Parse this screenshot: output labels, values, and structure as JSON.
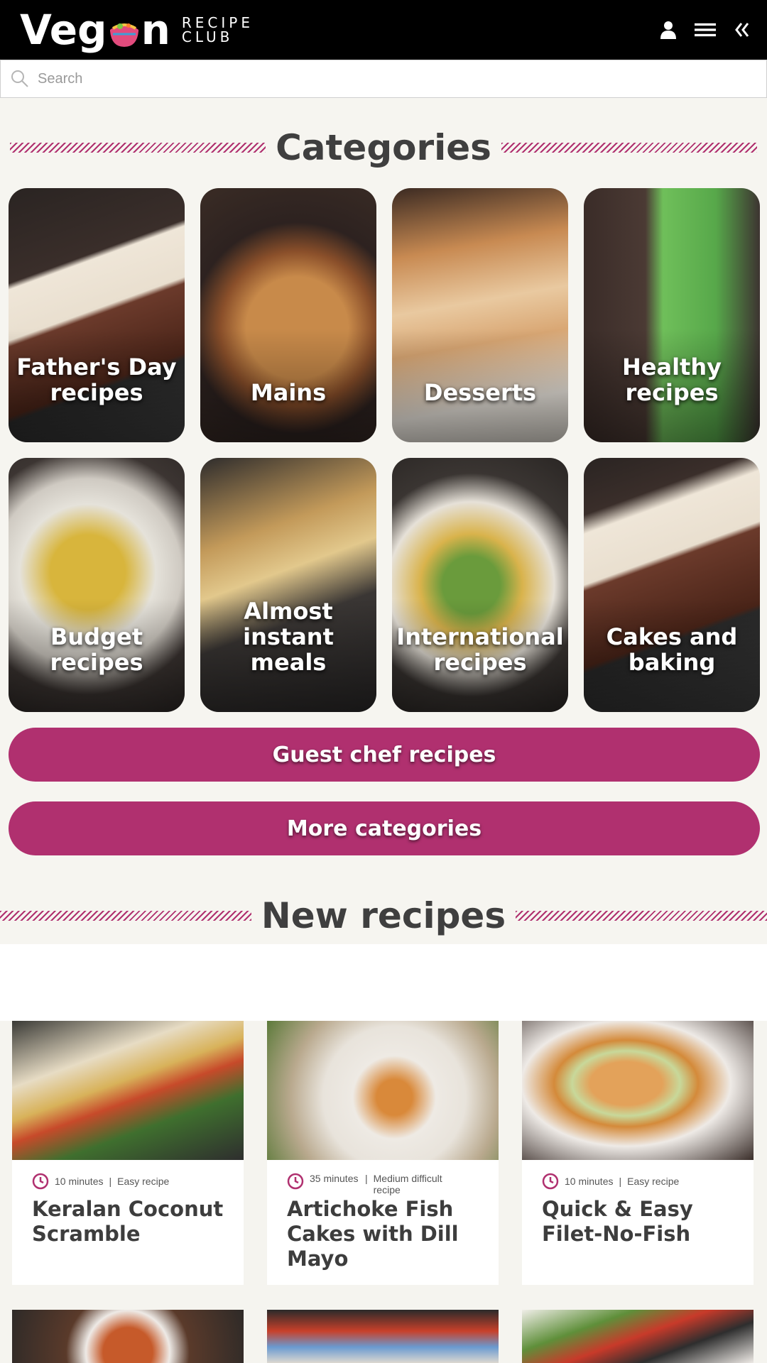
{
  "header": {
    "logo_main": "Vegan",
    "logo_sub_top": "RECIPE",
    "logo_sub_bottom": "CLUB",
    "icons": [
      "user-icon",
      "menu-icon",
      "double-chevron-left-icon"
    ]
  },
  "search": {
    "placeholder": "Search"
  },
  "sections": {
    "categories_title": "Categories",
    "new_recipes_title": "New recipes"
  },
  "categories": [
    {
      "label": "Father's Day recipes"
    },
    {
      "label": "Mains"
    },
    {
      "label": "Desserts"
    },
    {
      "label": "Healthy recipes"
    },
    {
      "label": "Budget recipes"
    },
    {
      "label": "Almost instant meals"
    },
    {
      "label": "International recipes"
    },
    {
      "label": "Cakes and baking"
    }
  ],
  "buttons": {
    "guest_chef": "Guest chef recipes",
    "more_categories": "More categories"
  },
  "recipes": [
    {
      "time": "10 minutes",
      "difficulty": "Easy recipe",
      "title": "Keralan Coconut Scramble"
    },
    {
      "time": "35 minutes",
      "difficulty": "Medium difficult recipe",
      "title": "Artichoke Fish Cakes with Dill Mayo"
    },
    {
      "time": "10 minutes",
      "difficulty": "Easy recipe",
      "title": "Quick & Easy Filet-No-Fish"
    }
  ],
  "colors": {
    "accent": "#b0306f",
    "header_bg": "#000000",
    "page_bg": "#f6f5f0"
  }
}
